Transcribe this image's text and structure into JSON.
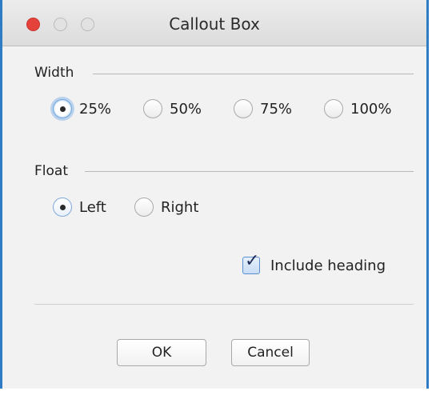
{
  "window": {
    "title": "Callout Box"
  },
  "width_section": {
    "label": "Width",
    "options": [
      "25%",
      "50%",
      "75%",
      "100%"
    ],
    "selected": "25%"
  },
  "float_section": {
    "label": "Float",
    "options": [
      "Left",
      "Right"
    ],
    "selected": "Left"
  },
  "include_heading": {
    "label": "Include heading",
    "checked": true
  },
  "buttons": {
    "ok": "OK",
    "cancel": "Cancel"
  },
  "colors": {
    "close_button": "#e4423b",
    "focus_ring": "#6fa3dc",
    "window_border": "#2f7cc6"
  }
}
